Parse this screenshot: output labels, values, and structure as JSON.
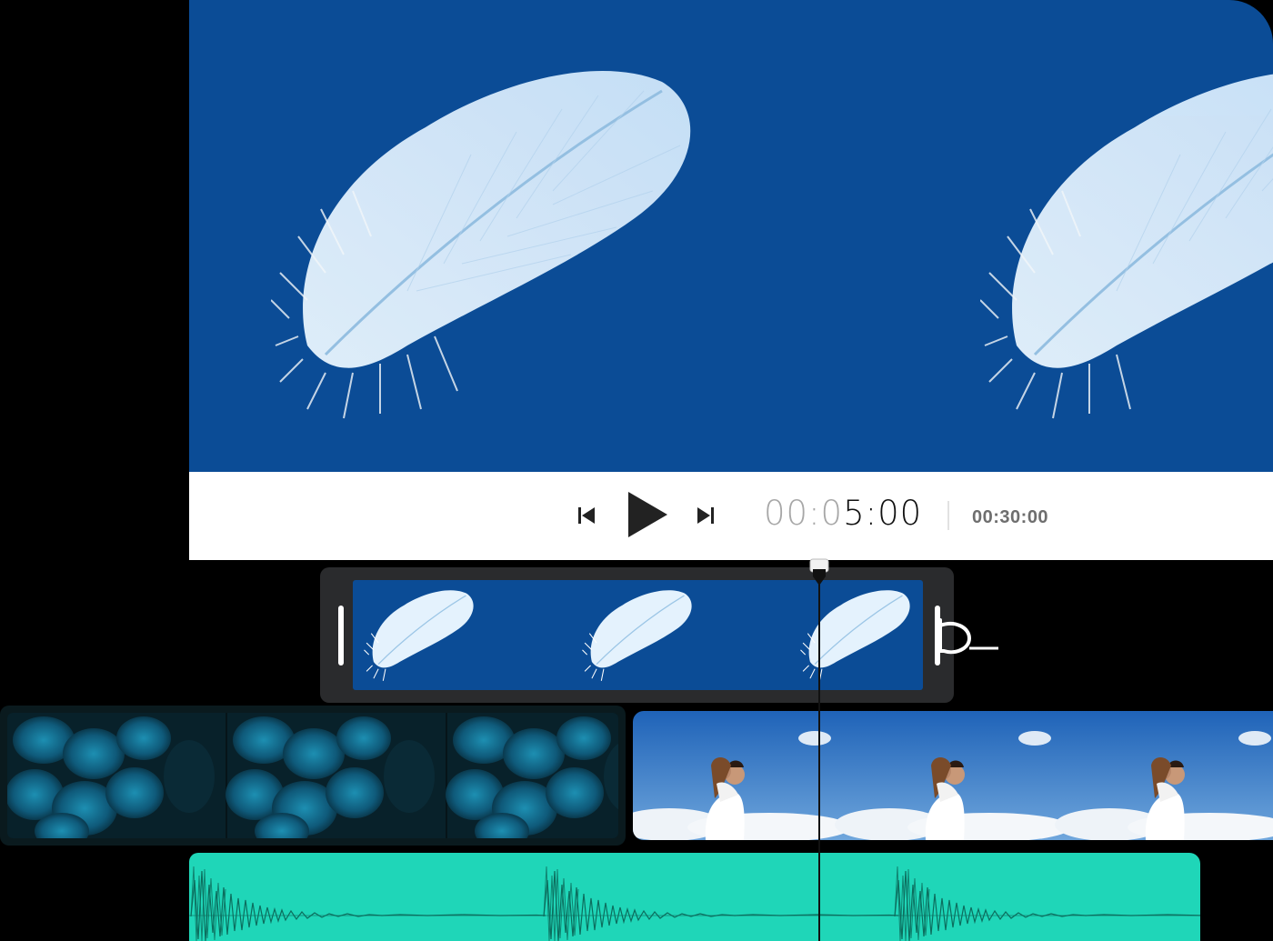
{
  "player": {
    "preview_image": "feather-on-blue",
    "controls": {
      "skip_back_icon": "skip-back-icon",
      "play_icon": "play-icon",
      "skip_forward_icon": "skip-forward-icon",
      "timecode_dim": "00:0",
      "timecode_main": "5:00",
      "duration": "00:30:00"
    }
  },
  "timeline": {
    "selected_clip": {
      "thumbnail": "feather-on-blue",
      "frames": 3
    },
    "video_clips": [
      {
        "thumbnail": "peacock-feathers",
        "frames": 3
      },
      {
        "thumbnail": "couple-embracing-sky",
        "frames": 3
      }
    ],
    "audio_clip": {
      "kind": "waveform",
      "segments": 3
    },
    "playhead_icon": "playhead-handle-icon",
    "cursor_icon": "hand-cursor-icon"
  },
  "colors": {
    "preview_bg": "#0b4c96",
    "audio_track": "#1fd6b8",
    "selected_clip_frame": "#2a2b2d",
    "controls_bg": "#ffffff"
  }
}
